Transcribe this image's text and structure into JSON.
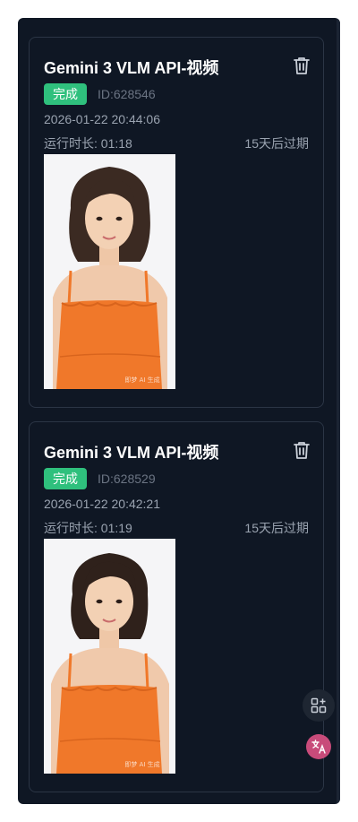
{
  "cards": [
    {
      "title": "Gemini 3 VLM API-视频",
      "status": "完成",
      "id_label": "ID:628546",
      "datetime": "2026-01-22 20:44:06",
      "runtime": "运行时长: 01:18",
      "expire": "15天后过期",
      "watermark": "即梦 AI 生成"
    },
    {
      "title": "Gemini 3 VLM API-视频",
      "status": "完成",
      "id_label": "ID:628529",
      "datetime": "2026-01-22 20:42:21",
      "runtime": "运行时长: 01:19",
      "expire": "15天后过期",
      "watermark": "即梦 AI 生成"
    }
  ],
  "floating": {
    "apps_icon": "apps-sparkle-icon",
    "translate_icon": "translate-icon"
  },
  "colors": {
    "background": "#0f1724",
    "card_border": "#2b3545",
    "status_badge": "#2fc07d",
    "dress": "#f0782a"
  }
}
